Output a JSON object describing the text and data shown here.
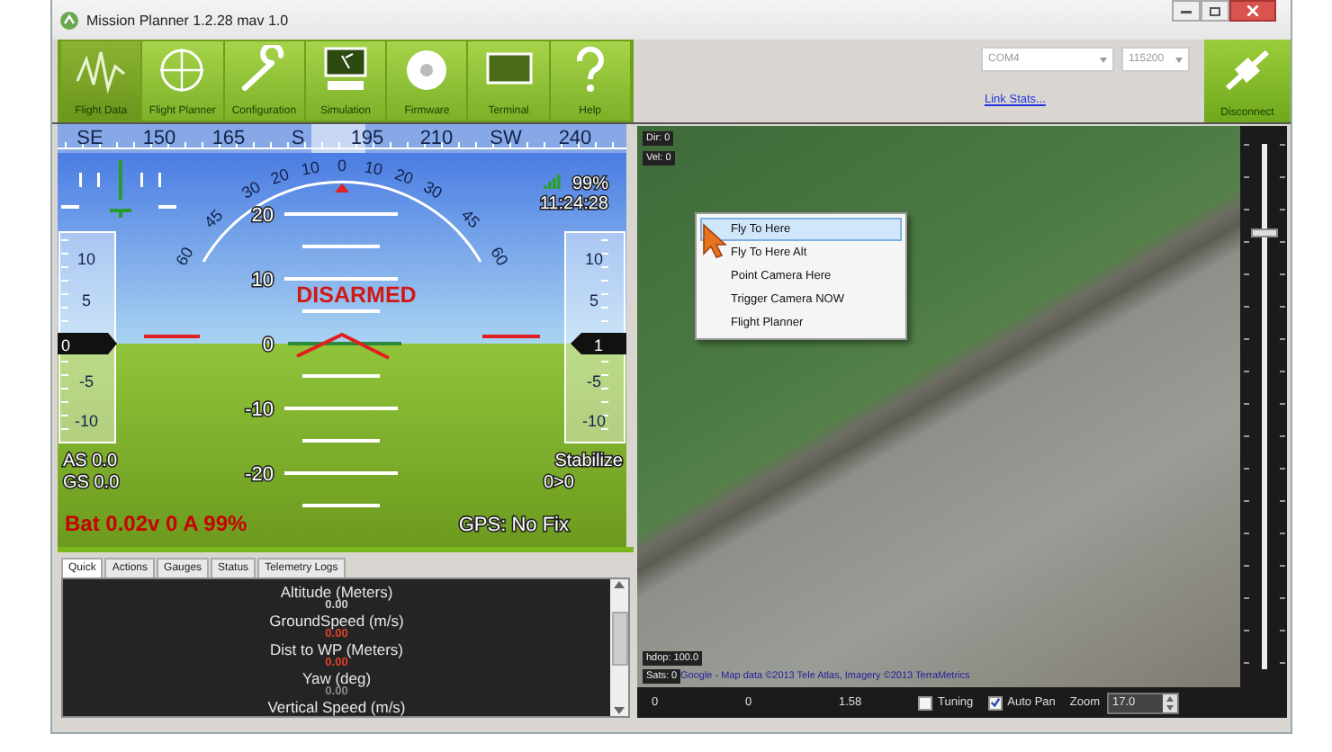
{
  "window": {
    "title": "Mission Planner 1.2.28 mav 1.0"
  },
  "toolbar": [
    {
      "label": "Flight Data",
      "kind": "graph",
      "selected": true
    },
    {
      "label": "Flight Planner",
      "kind": "crosshair",
      "selected": false
    },
    {
      "label": "Configuration",
      "kind": "wrench",
      "selected": false
    },
    {
      "label": "Simulation",
      "kind": "computer",
      "selected": false
    },
    {
      "label": "Firmware",
      "kind": "disc",
      "selected": false
    },
    {
      "label": "Terminal",
      "kind": "monitor",
      "selected": false
    },
    {
      "label": "Help",
      "kind": "help",
      "selected": false
    }
  ],
  "connection": {
    "port": "COM4",
    "baud": "115200",
    "link_stats": "Link Stats...",
    "connect_button": "Disconnect"
  },
  "hud": {
    "heading_labels": [
      "SE",
      "150",
      "165",
      "S",
      "195",
      "210",
      "SW",
      "240"
    ],
    "roll_labels": [
      "60",
      "45",
      "30",
      "20",
      "10",
      "0",
      "10",
      "20",
      "30",
      "45",
      "60"
    ],
    "pitch_labels": [
      "20",
      "10",
      "0",
      "-10",
      "-20"
    ],
    "speed_tape": {
      "labels": [
        "10",
        "5",
        "-5",
        "-10"
      ],
      "reading": "0"
    },
    "altitude_tape": {
      "labels": [
        "10",
        "5",
        "-5",
        "-10"
      ],
      "reading": "1"
    },
    "signal": "99%",
    "time": "11:24:28",
    "arm_status": "DISARMED",
    "airspeed": "AS 0.0",
    "groundspeed": "GS 0.0",
    "mode": "Stabilize",
    "waypoint": "0>0",
    "battery": "Bat 0.02v 0 A 99%",
    "gps": "GPS: No Fix"
  },
  "tabs": [
    {
      "label": "Quick",
      "selected": true
    },
    {
      "label": "Actions",
      "selected": false
    },
    {
      "label": "Gauges",
      "selected": false
    },
    {
      "label": "Status",
      "selected": false
    },
    {
      "label": "Telemetry Logs",
      "selected": false
    }
  ],
  "quick": [
    {
      "label": "Altitude (Meters)",
      "value": "0.00",
      "color": "#d0d0d0"
    },
    {
      "label": "GroundSpeed (m/s)",
      "value": "0.00",
      "color": "#e0402a"
    },
    {
      "label": "Dist to WP (Meters)",
      "value": "0.00",
      "color": "#e0402a"
    },
    {
      "label": "Yaw (deg)",
      "value": "0.00",
      "color": "#8a8a8a"
    },
    {
      "label": "Vertical Speed (m/s)"
    }
  ],
  "map": {
    "direction": "Dir: 0",
    "velocity": "Vel: 0",
    "hdop": "hdop: 100.0",
    "sats": "Sats: 0",
    "attribution": "Google - Map data ©2013 Tele Atlas, Imagery ©2013 TerraMetrics",
    "context_menu": [
      {
        "label": "Fly To Here",
        "selected": true
      },
      {
        "label": "Fly To Here Alt",
        "selected": false
      },
      {
        "label": "Point Camera Here",
        "selected": false
      },
      {
        "label": "Trigger Camera NOW",
        "selected": false
      },
      {
        "label": "Flight Planner",
        "selected": false
      }
    ],
    "zoom_slider": {
      "level": 0.83
    }
  },
  "status_bar": {
    "readings": [
      "0",
      "0",
      "1.58"
    ],
    "options": [
      {
        "label": "Tuning",
        "checked": false
      },
      {
        "label": "Auto Pan",
        "checked": true
      }
    ],
    "zoom_label": "Zoom",
    "zoom_value": "17.0"
  }
}
